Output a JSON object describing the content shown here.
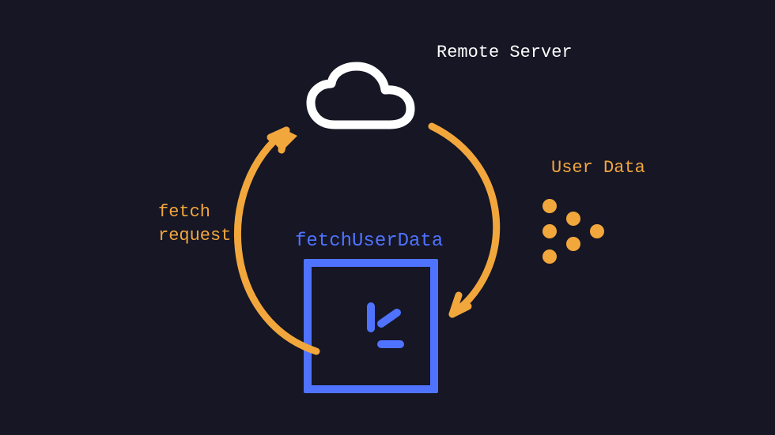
{
  "labels": {
    "remote_server": "Remote Server",
    "user_data": "User Data",
    "fetch_request_line1": "fetch",
    "fetch_request_line2": "request",
    "fetch_user_data": "fetchUserData"
  },
  "icons": {
    "cloud": "cloud-icon",
    "terminal": "terminal-icon",
    "left_arrow": "fetch-request-arrow",
    "right_arrow": "response-arrow",
    "data_dots": "data-stream-dots"
  },
  "colors": {
    "bg": "#161625",
    "orange": "#f2a73c",
    "blue": "#4f73ff",
    "white": "#ffffff"
  }
}
